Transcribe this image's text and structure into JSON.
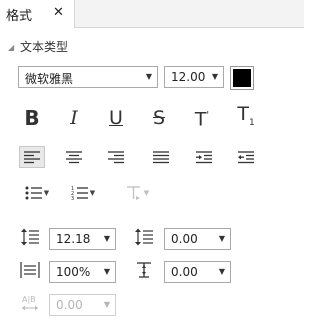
{
  "tabs": [
    {
      "label": "格式"
    }
  ],
  "section": {
    "title": "文本类型"
  },
  "font": {
    "family": "微软雅黑",
    "size": "12.00",
    "color": "#000000"
  },
  "spacing": {
    "line_spacing": "12.18",
    "para_before": "0.00",
    "scale": "100%",
    "para_after": "0.00",
    "char_spacing": "0.00"
  },
  "icons": [
    "bold-icon",
    "italic-icon",
    "underline-icon",
    "strikethrough-icon",
    "superscript-icon",
    "subscript-icon",
    "align-left-icon",
    "align-center-icon",
    "align-right-icon",
    "justify-icon",
    "indent-increase-icon",
    "indent-decrease-icon",
    "bullet-list-icon",
    "numbered-list-icon",
    "text-direction-icon",
    "line-spacing-icon",
    "paragraph-before-icon",
    "horizontal-scale-icon",
    "paragraph-after-icon",
    "character-spacing-icon"
  ]
}
